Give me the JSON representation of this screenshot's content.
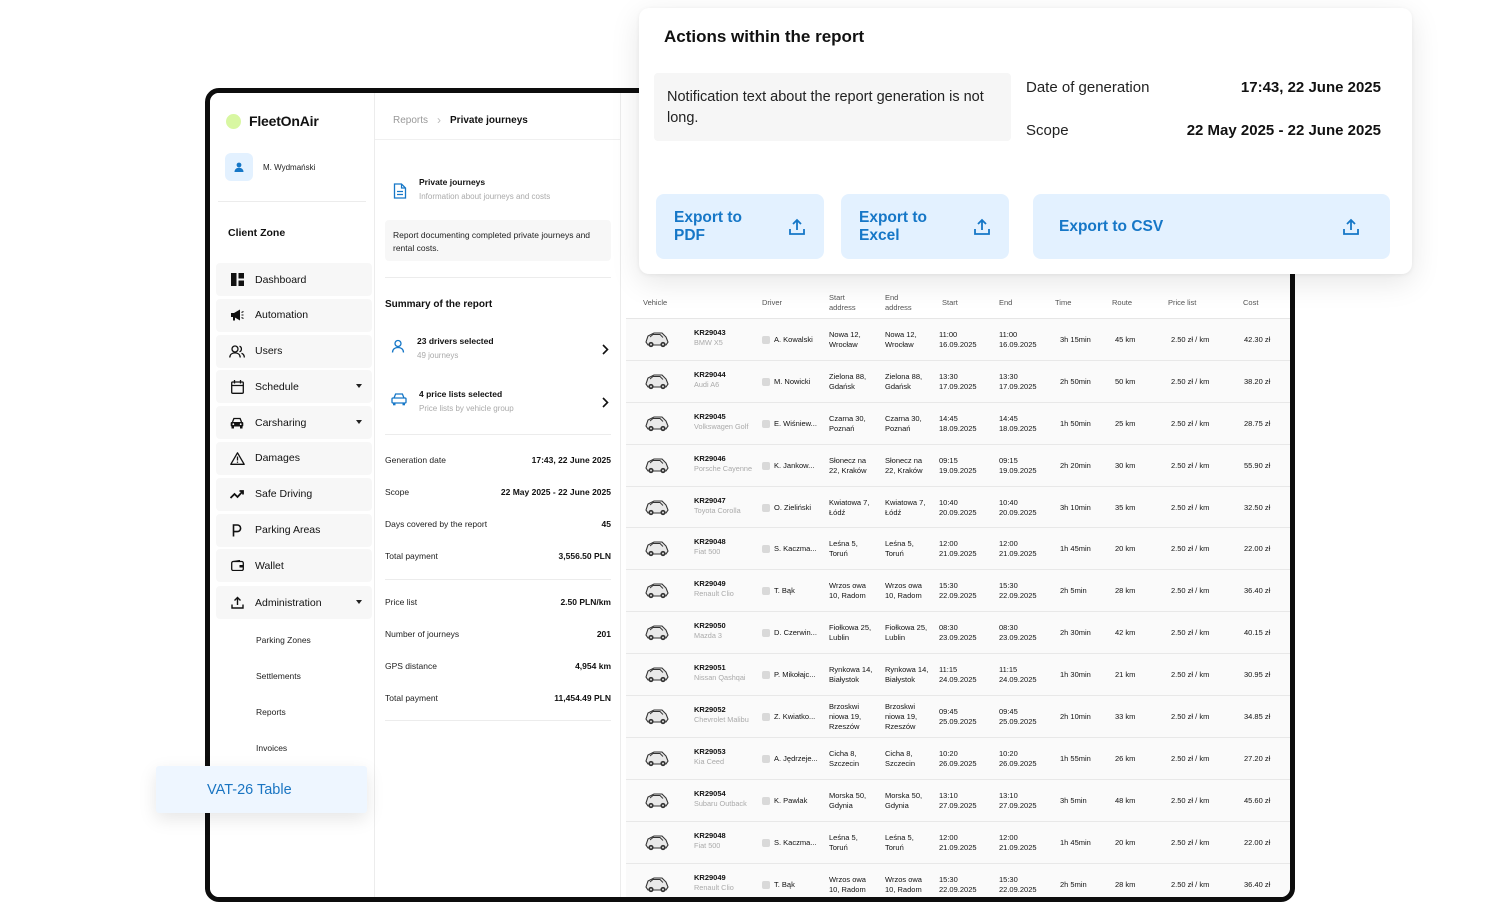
{
  "app": {
    "name": "FleetOnAir",
    "accent": "#1677c7",
    "logo_dot": "#d8f7a2"
  },
  "user": {
    "name": "M. Wydmański"
  },
  "sidebar": {
    "zone_title": "Client Zone",
    "items": [
      {
        "label": "Dashboard",
        "icon": "dashboard-icon"
      },
      {
        "label": "Automation",
        "icon": "megaphone-icon"
      },
      {
        "label": "Users",
        "icon": "users-icon"
      },
      {
        "label": "Schedule",
        "icon": "calendar-icon"
      },
      {
        "label": "Carsharing",
        "icon": "car-icon"
      },
      {
        "label": "Damages",
        "icon": "warning-icon"
      },
      {
        "label": "Safe Driving",
        "icon": "trend-icon"
      },
      {
        "label": "Parking Areas",
        "icon": "parking-icon"
      },
      {
        "label": "Wallet",
        "icon": "wallet-icon"
      },
      {
        "label": "Administration",
        "icon": "upload-icon"
      }
    ],
    "sub_items": [
      "Parking Zones",
      "Settlements",
      "Reports",
      "Invoices"
    ],
    "vat_overlay": "VAT-26 Table"
  },
  "breadcrumb": {
    "parent": "Reports",
    "current": "Private journeys"
  },
  "report": {
    "title": "Private journeys",
    "subtitle": "Information about journeys and costs",
    "description": "Report documenting completed private journeys and rental costs.",
    "summary_title": "Summary of the report",
    "drivers": {
      "title": "23 drivers selected",
      "sub": "49 journeys"
    },
    "price_lists": {
      "title": "4 price lists selected",
      "sub": "Price lists by vehicle group"
    },
    "kv1": [
      {
        "k": "Generation date",
        "v": "17:43, 22 June 2025"
      },
      {
        "k": "Scope",
        "v": "22 May 2025 - 22 June 2025"
      },
      {
        "k": "Days covered by the report",
        "v": "45"
      },
      {
        "k": "Total payment",
        "v": "3,556.50 PLN"
      }
    ],
    "kv2": [
      {
        "k": "Price list",
        "v": "2.50 PLN/km"
      },
      {
        "k": "Number of journeys",
        "v": "201"
      },
      {
        "k": "GPS distance",
        "v": "4,954 km"
      },
      {
        "k": "Total payment",
        "v": "11,454.49 PLN"
      }
    ]
  },
  "actions_panel": {
    "title": "Actions within the report",
    "notification": "Notification text about the report generation is not long.",
    "date_label": "Date of generation",
    "date_value": "17:43, 22 June 2025",
    "scope_label": "Scope",
    "scope_value": "22 May 2025 - 22 June 2025",
    "buttons": {
      "pdf": "Export to PDF",
      "excel": "Export to Excel",
      "csv": "Export to CSV"
    }
  },
  "table": {
    "headers": [
      "Vehicle",
      "Driver",
      "Start address",
      "End address",
      "Start",
      "End",
      "Time",
      "Route",
      "Price list",
      "Cost"
    ],
    "rows": [
      {
        "id": "KR29043",
        "model": "BMW X5",
        "driver": "A. Kowalski",
        "start_addr": "Nowa 12, Wrocław",
        "end_addr": "Nowa 12, Wrocław",
        "start": "11:00 16.09.2025",
        "end": "11:00 16.09.2025",
        "time": "3h 15min",
        "route": "45 km",
        "price": "2.50 zł / km",
        "cost": "42.30 zł"
      },
      {
        "id": "KR29044",
        "model": "Audi A6",
        "driver": "M. Nowicki",
        "start_addr": "Zielona 88, Gdańsk",
        "end_addr": "Zielona 88, Gdańsk",
        "start": "13:30 17.09.2025",
        "end": "13:30 17.09.2025",
        "time": "2h 50min",
        "route": "50 km",
        "price": "2.50 zł / km",
        "cost": "38.20 zł"
      },
      {
        "id": "KR29045",
        "model": "Volkswagen Golf",
        "driver": "E. Wiśniew...",
        "start_addr": "Czarna 30, Poznań",
        "end_addr": "Czarna 30, Poznań",
        "start": "14:45 18.09.2025",
        "end": "14:45 18.09.2025",
        "time": "1h 50min",
        "route": "25 km",
        "price": "2.50 zł / km",
        "cost": "28.75 zł"
      },
      {
        "id": "KR29046",
        "model": "Porsche Cayenne",
        "driver": "K. Jankow...",
        "start_addr": "Słonecz na 22, Kraków",
        "end_addr": "Słonecz na 22, Kraków",
        "start": "09:15 19.09.2025",
        "end": "09:15 19.09.2025",
        "time": "2h 20min",
        "route": "30 km",
        "price": "2.50 zł / km",
        "cost": "55.90 zł"
      },
      {
        "id": "KR29047",
        "model": "Toyota Corolla",
        "driver": "O. Zieliński",
        "start_addr": "Kwiatowa 7, Łódź",
        "end_addr": "Kwiatowa 7, Łódź",
        "start": "10:40 20.09.2025",
        "end": "10:40 20.09.2025",
        "time": "3h 10min",
        "route": "35 km",
        "price": "2.50 zł / km",
        "cost": "32.50 zł"
      },
      {
        "id": "KR29048",
        "model": "Fiat 500",
        "driver": "S. Kaczma...",
        "start_addr": "Leśna 5, Toruń",
        "end_addr": "Leśna 5, Toruń",
        "start": "12:00 21.09.2025",
        "end": "12:00 21.09.2025",
        "time": "1h 45min",
        "route": "20 km",
        "price": "2.50 zł / km",
        "cost": "22.00 zł"
      },
      {
        "id": "KR29049",
        "model": "Renault Clio",
        "driver": "T. Bąk",
        "start_addr": "Wrzos owa 10, Radom",
        "end_addr": "Wrzos owa 10, Radom",
        "start": "15:30 22.09.2025",
        "end": "15:30 22.09.2025",
        "time": "2h 5min",
        "route": "28 km",
        "price": "2.50 zł / km",
        "cost": "36.40 zł"
      },
      {
        "id": "KR29050",
        "model": "Mazda 3",
        "driver": "D. Czerwin...",
        "start_addr": "Fiołkowa 25, Lublin",
        "end_addr": "Fiołkowa 25, Lublin",
        "start": "08:30 23.09.2025",
        "end": "08:30 23.09.2025",
        "time": "2h 30min",
        "route": "42 km",
        "price": "2.50 zł / km",
        "cost": "40.15 zł"
      },
      {
        "id": "KR29051",
        "model": "Nissan Qashqai",
        "driver": "P. Mikołajc...",
        "start_addr": "Rynkowa 14, Białystok",
        "end_addr": "Rynkowa 14, Białystok",
        "start": "11:15 24.09.2025",
        "end": "11:15 24.09.2025",
        "time": "1h 30min",
        "route": "21 km",
        "price": "2.50 zł / km",
        "cost": "30.95 zł"
      },
      {
        "id": "KR29052",
        "model": "Chevrolet Malibu",
        "driver": "Z. Kwiatko...",
        "start_addr": "Brzoskwi niowa 19, Rzeszów",
        "end_addr": "Brzoskwi niowa 19, Rzeszów",
        "start": "09:45 25.09.2025",
        "end": "09:45 25.09.2025",
        "time": "2h 10min",
        "route": "33 km",
        "price": "2.50 zł / km",
        "cost": "34.85 zł"
      },
      {
        "id": "KR29053",
        "model": "Kia Ceed",
        "driver": "A. Jędrzeje...",
        "start_addr": "Cicha 8, Szczecin",
        "end_addr": "Cicha 8, Szczecin",
        "start": "10:20 26.09.2025",
        "end": "10:20 26.09.2025",
        "time": "1h 55min",
        "route": "26 km",
        "price": "2.50 zł / km",
        "cost": "27.20 zł"
      },
      {
        "id": "KR29054",
        "model": "Subaru Outback",
        "driver": "K. Pawlak",
        "start_addr": "Morska 50, Gdynia",
        "end_addr": "Morska 50, Gdynia",
        "start": "13:10 27.09.2025",
        "end": "13:10 27.09.2025",
        "time": "3h 5min",
        "route": "48 km",
        "price": "2.50 zł / km",
        "cost": "45.60 zł"
      },
      {
        "id": "KR29048",
        "model": "Fiat 500",
        "driver": "S. Kaczma...",
        "start_addr": "Leśna 5, Toruń",
        "end_addr": "Leśna 5, Toruń",
        "start": "12:00 21.09.2025",
        "end": "12:00 21.09.2025",
        "time": "1h 45min",
        "route": "20 km",
        "price": "2.50 zł / km",
        "cost": "22.00 zł"
      },
      {
        "id": "KR29049",
        "model": "Renault Clio",
        "driver": "T. Bąk",
        "start_addr": "Wrzos owa 10, Radom",
        "end_addr": "Wrzos owa 10, Radom",
        "start": "15:30 22.09.2025",
        "end": "15:30 22.09.2025",
        "time": "2h 5min",
        "route": "28 km",
        "price": "2.50 zł / km",
        "cost": "36.40 zł"
      }
    ]
  }
}
